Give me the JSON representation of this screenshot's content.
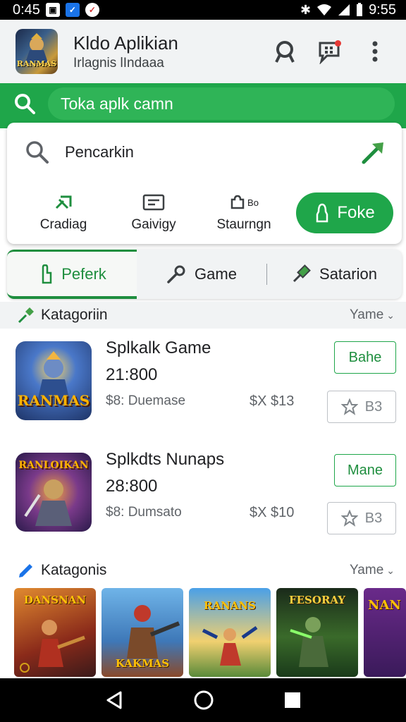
{
  "status_bar": {
    "time": "0:45",
    "right_time": "9:55",
    "left_icons": [
      "photo-icon",
      "mail-icon",
      "shield-icon"
    ],
    "right_icons": [
      "bluetooth-icon",
      "wifi-icon",
      "signal-icon",
      "battery-icon"
    ]
  },
  "header": {
    "title": "Kldo Aplikian",
    "subtitle": "Irlagnis lIndaaa",
    "logo_text": "RANMAS",
    "icons": [
      "account-icon",
      "notifications-icon",
      "more-vert-icon"
    ]
  },
  "green_search": {
    "placeholder": "Toka aplk camn"
  },
  "search_card": {
    "search_label": "Pencarkin",
    "categories": [
      {
        "label": "Cradiag",
        "icon": "pin-icon"
      },
      {
        "label": "Gaivigy",
        "icon": "card-icon"
      },
      {
        "label": "Staurngn",
        "icon": "puzzle-icon",
        "icon_text": "Bo"
      }
    ],
    "foke_label": "Foke"
  },
  "tabs": [
    {
      "label": "Peferk",
      "icon": "hand-icon",
      "active": true
    },
    {
      "label": "Game",
      "icon": "key-icon",
      "active": false
    },
    {
      "label": "Satarion",
      "icon": "paint-icon",
      "active": false
    }
  ],
  "section1": {
    "title": "Katagoriin",
    "more": "Yame"
  },
  "apps": [
    {
      "name": "Splkalk Game",
      "count": "21:800",
      "meta": "$8: Duemase",
      "price": "$X $13",
      "action": "Bahe",
      "rating": "B3",
      "thumb_text": "RANMAS"
    },
    {
      "name": "Splkdts Nunaps",
      "count": "28:800",
      "meta": "$8: Dumsato",
      "price": "$X $10",
      "action": "Mane",
      "rating": "B3",
      "thumb_text": "RANLOIKAN"
    }
  ],
  "section2": {
    "title": "Katagonis",
    "more": "Yame"
  },
  "carousel": [
    {
      "title": "DANSNAN"
    },
    {
      "title": "KAKMAS"
    },
    {
      "title": "RANANS"
    },
    {
      "title": "FESORAY"
    },
    {
      "title": "NAN"
    }
  ],
  "colors": {
    "brand_green": "#1fa64a",
    "accent_green": "#1e8e3e",
    "header_bg": "#f1f3f4"
  }
}
